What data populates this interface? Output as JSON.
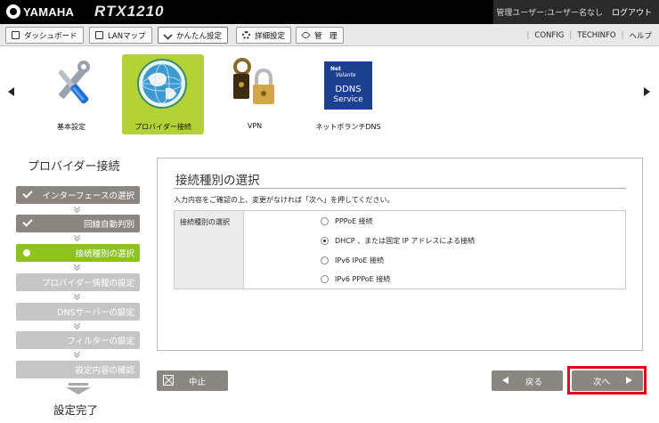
{
  "header": {
    "brand": "YAMAHA",
    "model": "RTX1210",
    "user": "管理ユーザー:ユーザー名なし",
    "logout": "ログアウト"
  },
  "tabs": [
    {
      "label": "ダッシュボード",
      "icon": "dashboard-icon"
    },
    {
      "label": "LANマップ",
      "icon": "lan-map-icon"
    },
    {
      "label": "かんたん設定",
      "icon": "easy-setup-icon",
      "active": true
    },
    {
      "label": "詳細設定",
      "icon": "gear-icon"
    },
    {
      "label": "管　理",
      "icon": "wrench-icon"
    }
  ],
  "top_links": [
    "CONFIG",
    "TECHINFO",
    "ヘルプ"
  ],
  "menu": [
    {
      "label": "基本設定",
      "icon": "tools-icon"
    },
    {
      "label": "プロバイダー接続",
      "icon": "globe-icon",
      "selected": true
    },
    {
      "label": "VPN",
      "icon": "vpn-lock-icon"
    },
    {
      "label": "ネットボランチDNS",
      "icon": "ddns-service-icon"
    }
  ],
  "ddns_logo": {
    "line1": "Net",
    "line2": "Volante",
    "line3": "DDNS",
    "line4": "Service"
  },
  "steps": {
    "title": "プロバイダー接続",
    "items": [
      {
        "label": "インターフェースの選択",
        "state": "done"
      },
      {
        "label": "回線自動判別",
        "state": "done"
      },
      {
        "label": "接続種別の選択",
        "state": "current"
      },
      {
        "label": "プロバイダー情報の設定",
        "state": "todo"
      },
      {
        "label": "DNSサーバーの設定",
        "state": "todo"
      },
      {
        "label": "フィルターの設定",
        "state": "todo"
      },
      {
        "label": "設定内容の確認",
        "state": "todo"
      }
    ],
    "finish": "設定完了"
  },
  "main": {
    "title": "接続種別の選択",
    "description": "入力内容をご確認の上、変更がなければ「次へ」を押してください。",
    "field_label": "接続種別の選択",
    "options": [
      {
        "label": "PPPoE 接続",
        "checked": false
      },
      {
        "label": "DHCP 、または固定 IP アドレスによる接続",
        "checked": true
      },
      {
        "label": "IPv6 IPoE 接続",
        "checked": false
      },
      {
        "label": "IPv6 PPPoE 接続",
        "checked": false
      }
    ]
  },
  "buttons": {
    "cancel": "中止",
    "back": "戻る",
    "next": "次へ"
  },
  "colors": {
    "accent_green": "#8dc21f",
    "button_gray": "#8c8680",
    "highlight_red": "#e5001a"
  }
}
